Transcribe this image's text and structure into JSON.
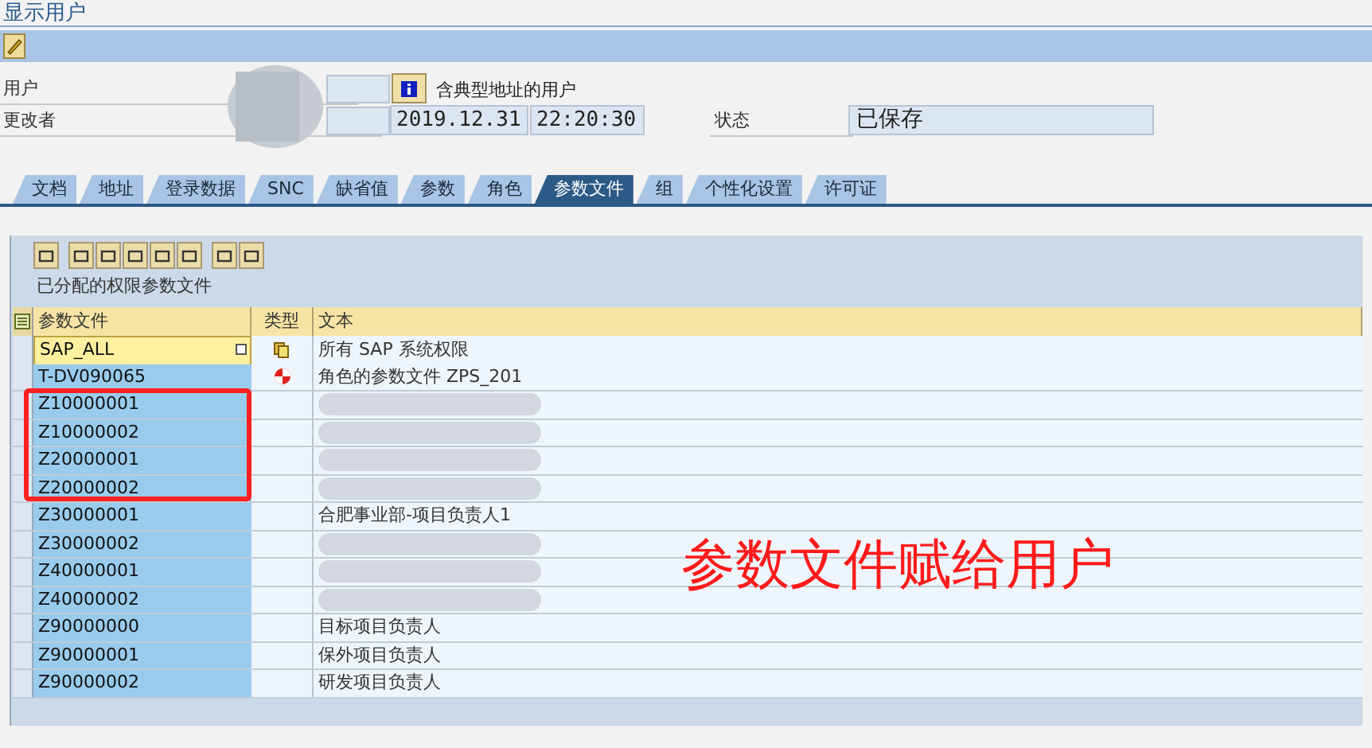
{
  "window": {
    "title": "显示用户"
  },
  "header": {
    "user_label": "用户",
    "user_info": "含典型地址的用户",
    "changed_by_label": "更改者",
    "date": "2019.12.31",
    "time": "22:20:30",
    "status_label": "状态",
    "status": "已保存"
  },
  "tabs": [
    {
      "label": "文档",
      "selected": false
    },
    {
      "label": "地址",
      "selected": false
    },
    {
      "label": "登录数据",
      "selected": false
    },
    {
      "label": "SNC",
      "selected": false
    },
    {
      "label": "缺省值",
      "selected": false
    },
    {
      "label": "参数",
      "selected": false
    },
    {
      "label": "角色",
      "selected": false
    },
    {
      "label": "参数文件",
      "selected": true
    },
    {
      "label": "组",
      "selected": false
    },
    {
      "label": "个性化设置",
      "selected": false
    },
    {
      "label": "许可证",
      "selected": false
    }
  ],
  "table": {
    "title": "已分配的权限参数文件",
    "columns": [
      "参数文件",
      "类型",
      "文本"
    ],
    "rows": [
      {
        "profile": "SAP_ALL",
        "kind": "composite",
        "text": "所有 SAP 系统权限",
        "focused": true
      },
      {
        "profile": "T-DV090065",
        "kind": "generated",
        "text": "角色的参数文件 ZPS_201",
        "focused": false
      },
      {
        "profile": "Z10000001",
        "focused": false,
        "blurred": true
      },
      {
        "profile": "Z10000002",
        "focused": false,
        "blurred": true
      },
      {
        "profile": "Z20000001",
        "focused": false,
        "blurred": true
      },
      {
        "profile": "Z20000002",
        "focused": false,
        "blurred": true
      },
      {
        "profile": "Z30000001",
        "text": "合肥事业部-项目负责人1",
        "focused": false,
        "blurred": false
      },
      {
        "profile": "Z30000002",
        "focused": false,
        "blurred": true
      },
      {
        "profile": "Z40000001",
        "focused": false,
        "blurred": true
      },
      {
        "profile": "Z40000002",
        "focused": false,
        "blurred": true
      },
      {
        "profile": "Z90000000",
        "text": "目标项目负责人",
        "focused": false,
        "blurred": false
      },
      {
        "profile": "Z90000001",
        "text": "保外项目负责人",
        "focused": false,
        "blurred": false
      },
      {
        "profile": "Z90000002",
        "text": "研发项目负责人",
        "focused": false,
        "blurred": false
      }
    ]
  },
  "annotation": {
    "text": "参数文件赋给用户"
  }
}
